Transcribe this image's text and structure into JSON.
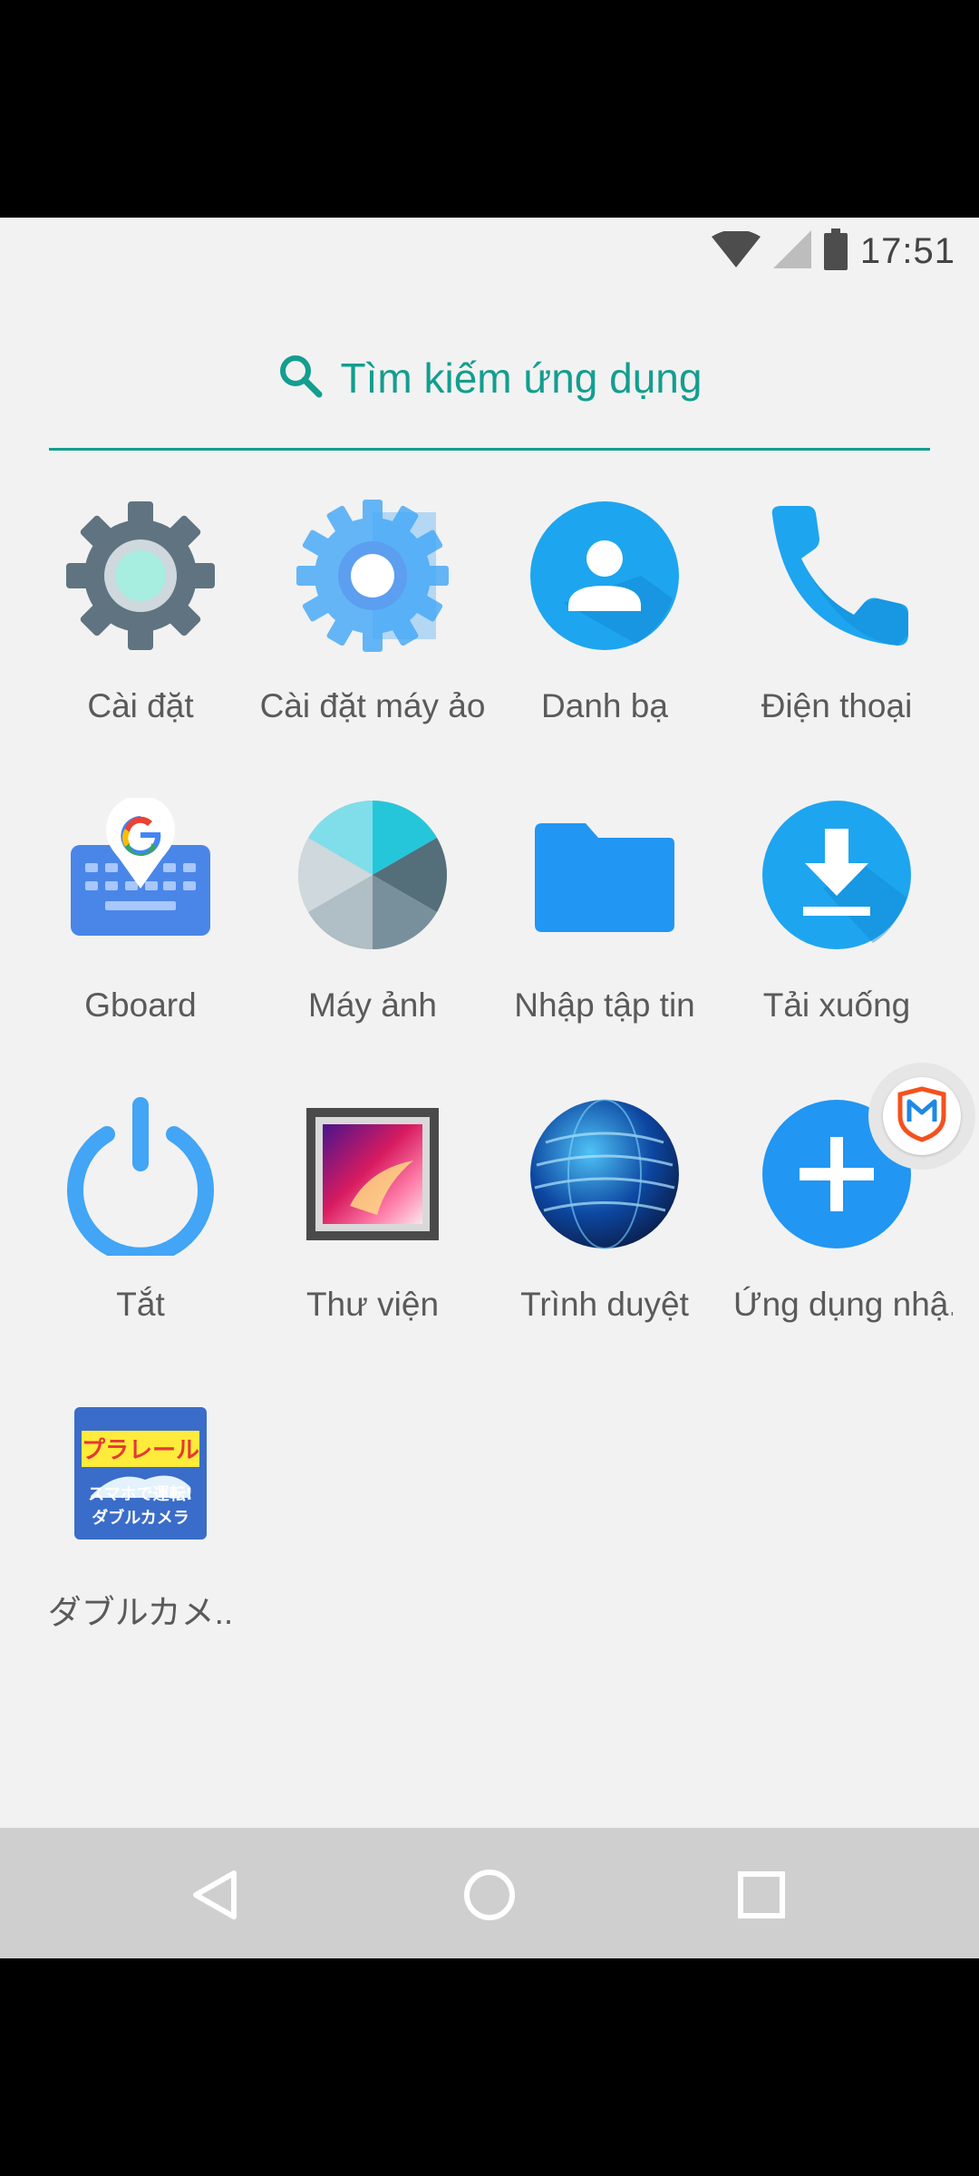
{
  "status_bar": {
    "time": "17:51",
    "icons": [
      "wifi-icon",
      "signal-icon",
      "battery-icon"
    ]
  },
  "search": {
    "label": "Tìm kiếm ứng dụng",
    "icon": "search-icon",
    "accent_color": "#139e8f"
  },
  "apps": [
    {
      "label": "Cài đặt",
      "icon": "settings-gear-icon"
    },
    {
      "label": "Cài đặt máy ảo",
      "icon": "vm-settings-gear-icon"
    },
    {
      "label": "Danh bạ",
      "icon": "contacts-icon"
    },
    {
      "label": "Điện thoại",
      "icon": "phone-icon"
    },
    {
      "label": "Gboard",
      "icon": "gboard-icon"
    },
    {
      "label": "Máy ảnh",
      "icon": "camera-aperture-icon"
    },
    {
      "label": "Nhập tập tin",
      "icon": "folder-icon"
    },
    {
      "label": "Tải xuống",
      "icon": "download-icon"
    },
    {
      "label": "Tắt",
      "icon": "power-icon"
    },
    {
      "label": "Thư viện",
      "icon": "gallery-icon"
    },
    {
      "label": "Trình duyệt",
      "icon": "globe-icon"
    },
    {
      "label": "Ứng dụng nhậ..",
      "icon": "add-app-icon"
    },
    {
      "label": "ダブルカメ..",
      "icon": "plarail-double-camera-icon",
      "icon_text_top": "プラレール",
      "icon_text_bottom_1": "スマホで運転!",
      "icon_text_bottom_2": "ダブルカメラ"
    }
  ],
  "floating_badge": {
    "icon": "m-shield-icon"
  },
  "nav_bar": {
    "buttons": [
      "back-icon",
      "home-icon",
      "recents-icon"
    ]
  }
}
